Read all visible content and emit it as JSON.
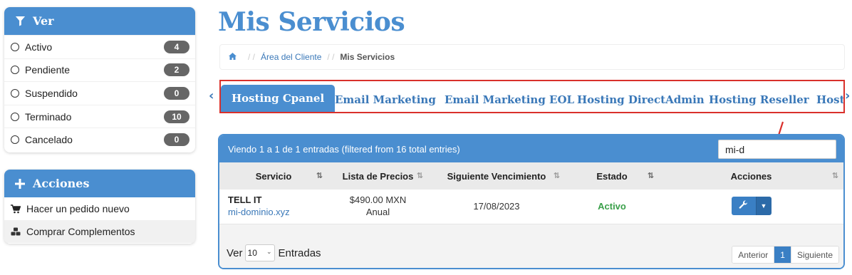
{
  "sidebar": {
    "filter_panel": {
      "title": "Ver",
      "items": [
        {
          "label": "Activo",
          "count": "4"
        },
        {
          "label": "Pendiente",
          "count": "2"
        },
        {
          "label": "Suspendido",
          "count": "0"
        },
        {
          "label": "Terminado",
          "count": "10"
        },
        {
          "label": "Cancelado",
          "count": "0"
        }
      ]
    },
    "actions_panel": {
      "title": "Acciones",
      "items": [
        {
          "label": "Hacer un pedido nuevo",
          "icon": "shopping-cart-icon"
        },
        {
          "label": "Comprar Complementos",
          "icon": "cubes-icon"
        }
      ]
    }
  },
  "page": {
    "title": "Mis Servicios",
    "breadcrumb": {
      "link": "Área del Cliente",
      "current": "Mis Servicios"
    }
  },
  "tabs": [
    {
      "label": "Hosting Cpanel",
      "active": true
    },
    {
      "label": "Email Marketing",
      "active": false
    },
    {
      "label": "Email Marketing EOL",
      "active": false
    },
    {
      "label": "Hosting DirectAdmin",
      "active": false
    },
    {
      "label": "Hosting Reseller",
      "active": false
    },
    {
      "label": "Hosti",
      "active": false
    }
  ],
  "table": {
    "info": "Viendo 1 a 1 de 1 entradas (filtered from 16 total entries)",
    "search_value": "mi-d",
    "columns": [
      "Servicio",
      "Lista de Precios",
      "Siguiente Vencimiento",
      "Estado",
      "Acciones"
    ],
    "rows": [
      {
        "service_name": "TELL IT",
        "service_domain": "mi-dominio.xyz",
        "price": "$490.00 MXN",
        "cycle": "Anual",
        "next_due": "17/08/2023",
        "status": "Activo"
      }
    ],
    "footer": {
      "show_label": "Ver",
      "page_size": "10",
      "entries_label": "Entradas",
      "prev_label": "Anterior",
      "current_page": "1",
      "next_label": "Siguiente"
    }
  },
  "colors": {
    "brand_blue": "#4a8ed0",
    "link_blue": "#3a78b8",
    "status_green": "#3aa04a",
    "highlight_red": "#d9302b"
  }
}
